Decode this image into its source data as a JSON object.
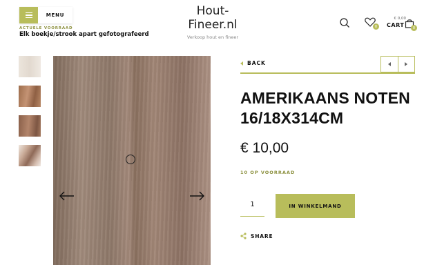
{
  "header": {
    "menu_label": "MENU",
    "promo_subtitle": "ACTUELE VOORRAAD",
    "promo_title": "Elk boekje/strook apart gefotografeerd",
    "logo_line1": "Hout-",
    "logo_line2": "Fineer.nl",
    "logo_tagline": "Verkoop hout en fineer",
    "wishlist_count": "0",
    "cart_price": "€ 0,00",
    "cart_label": "CART",
    "cart_count": "0"
  },
  "gallery": {
    "thumbnails": [
      "thumb-1",
      "thumb-2",
      "thumb-3",
      "thumb-4"
    ]
  },
  "product": {
    "back_label": "BACK",
    "title_line1": "AMERIKAANS NOTEN",
    "title_line2": "16/18X314CM",
    "price": "€ 10,00",
    "stock": "10 OP VOORRAAD",
    "quantity": "1",
    "add_to_cart_label": "IN WINKELMAND",
    "share_label": "SHARE"
  },
  "colors": {
    "accent": "#b8bd5b",
    "accent_text": "#8d9140"
  }
}
